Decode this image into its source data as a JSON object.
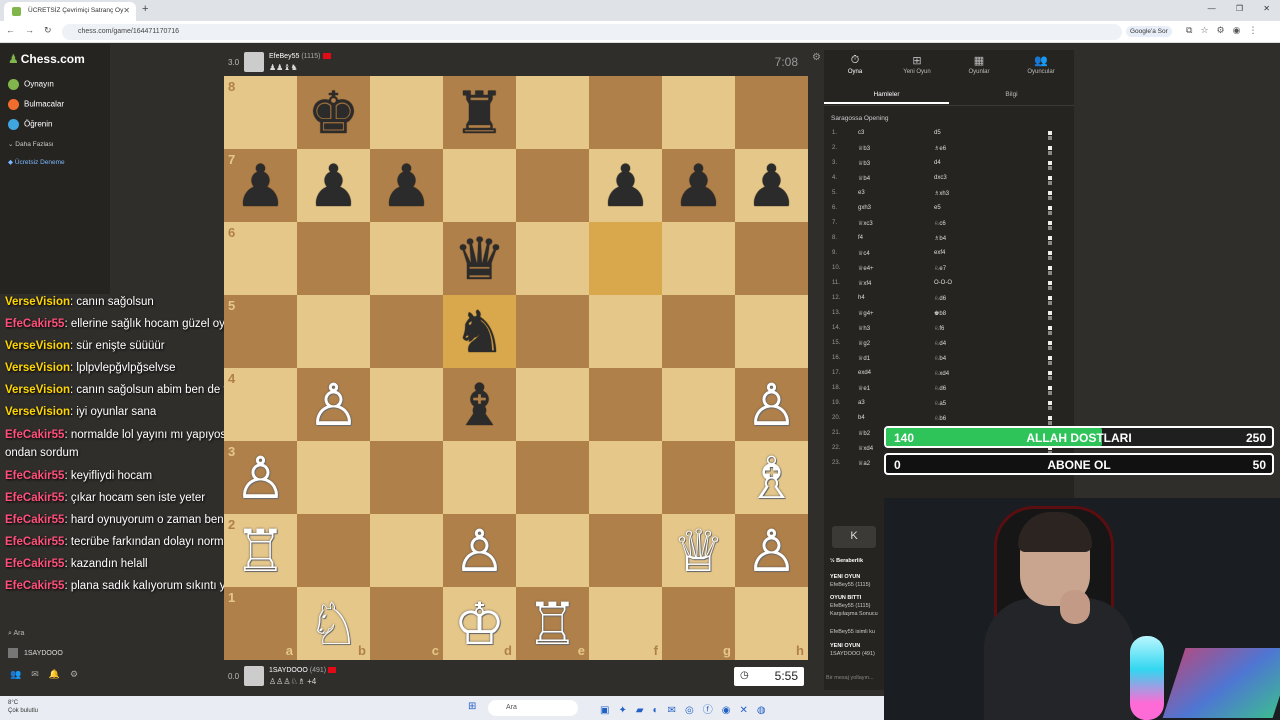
{
  "browser": {
    "tab_title": "ÜCRETSİZ Çevrimiçi Satranç Oy",
    "url": "chess.com/game/164471170716",
    "google_button": "Google'a Sor"
  },
  "leftnav": {
    "logo": "Chess.com",
    "items": [
      {
        "label": "Oynayın",
        "color": "#81b64c"
      },
      {
        "label": "Bulmacalar",
        "color": "#f16d2d"
      },
      {
        "label": "Öğrenin",
        "color": "#3fa7e0"
      },
      {
        "label": "Daha Fazlası"
      },
      {
        "label": "Ücretsiz Deneme"
      }
    ],
    "search": "Ara",
    "username": "1SAYDOOO"
  },
  "chat": [
    {
      "user": "VerseVision",
      "text": ": canın sağolsun",
      "cls": "u1"
    },
    {
      "user": "EfeCakir55",
      "text": ": ellerine sağlık hocam güzel oyundu",
      "cls": "u2"
    },
    {
      "user": "VerseVision",
      "text": ": sür enişte süüüür",
      "cls": "u1"
    },
    {
      "user": "VerseVision",
      "text": ": lplpvlepğvlpğselvse",
      "cls": "u1"
    },
    {
      "user": "VerseVision",
      "text": ": canın sağolsun abim ben de fazla duramayacam",
      "cls": "u1"
    },
    {
      "user": "VerseVision",
      "text": ": iyi oyunlar sana",
      "cls": "u1"
    },
    {
      "user": "EfeCakir55",
      "text": ": normalde lol yayını mı yapıyosun hocam arkadş demişti ya ondan sordum",
      "cls": "u2"
    },
    {
      "user": "EfeCakir55",
      "text": ": keyifliydi hocam",
      "cls": "u2"
    },
    {
      "user": "EfeCakir55",
      "text": ": çıkar hocam sen iste yeter",
      "cls": "u2"
    },
    {
      "user": "EfeCakir55",
      "text": ": hard oynuyorum o zaman bende hadi bakalımm",
      "cls": "u2"
    },
    {
      "user": "EfeCakir55",
      "text": ": tecrübe farkından dolayı normal ya ben çok oynadım",
      "cls": "u2"
    },
    {
      "user": "EfeCakir55",
      "text": ": kazandın helall",
      "cls": "u2"
    },
    {
      "user": "EfeCakir55",
      "text": ": plana sadık kalıyorum sıkıntı yokk",
      "cls": "u2"
    }
  ],
  "top_player": {
    "score": "3.0",
    "name": "EfeBey55",
    "rating": "(1115)",
    "captured": "♟♟♝♞",
    "clock": "7:08"
  },
  "bottom_player": {
    "score": "0.0",
    "name": "1SAYDOOO",
    "rating": "(491)",
    "captured": "♙♙♙♘♗ +4",
    "clock": "5:55"
  },
  "board": {
    "ranks": [
      "8",
      "7",
      "6",
      "5",
      "4",
      "3",
      "2",
      "1"
    ],
    "files": [
      "a",
      "b",
      "c",
      "d",
      "e",
      "f",
      "g",
      "h"
    ],
    "highlight": [
      "f6",
      "d5"
    ],
    "position": {
      "b8": "♚",
      "d8": "♜",
      "a7": "♟",
      "b7": "♟",
      "c7": "♟",
      "f7": "♟",
      "g7": "♟",
      "h7": "♟",
      "d6": "♛",
      "d5": "♞",
      "b4": "♙",
      "d4": "♝",
      "h4": "♙",
      "a3": "♙",
      "h3": "♗",
      "a2": "♖",
      "d2": "♙",
      "g2": "♕",
      "h2": "♙",
      "b1": "♘",
      "d1": "♔",
      "e1": "♖"
    }
  },
  "rightpanel": {
    "tabs": [
      "Oyna",
      "Yeni Oyun",
      "Oyunlar",
      "Oyuncular"
    ],
    "subtabs": [
      "Hamleler",
      "Bilgi"
    ],
    "opening": "Saragossa Opening",
    "moves": [
      {
        "n": "1.",
        "w": "c3",
        "b": "d5"
      },
      {
        "n": "2.",
        "w": "♕b3",
        "b": "♗e6"
      },
      {
        "n": "3.",
        "w": "♕b3",
        "b": "d4"
      },
      {
        "n": "4.",
        "w": "♕b4",
        "b": "dxc3"
      },
      {
        "n": "5.",
        "w": "e3",
        "b": "♗xh3"
      },
      {
        "n": "6.",
        "w": "gxh3",
        "b": "e5"
      },
      {
        "n": "7.",
        "w": "♕xc3",
        "b": "♘c6"
      },
      {
        "n": "8.",
        "w": "f4",
        "b": "♗b4"
      },
      {
        "n": "9.",
        "w": "♕c4",
        "b": "exf4"
      },
      {
        "n": "10.",
        "w": "♕e4+",
        "b": "♘e7"
      },
      {
        "n": "11.",
        "w": "♕xf4",
        "b": "O-O-O"
      },
      {
        "n": "12.",
        "w": "h4",
        "b": "♘d6"
      },
      {
        "n": "13.",
        "w": "♕g4+",
        "b": "♚b8"
      },
      {
        "n": "14.",
        "w": "♕h3",
        "b": "♘f6"
      },
      {
        "n": "15.",
        "w": "♕g2",
        "b": "♘d4"
      },
      {
        "n": "16.",
        "w": "♕d1",
        "b": "♘b4"
      },
      {
        "n": "17.",
        "w": "exd4",
        "b": "♘xd4"
      },
      {
        "n": "18.",
        "w": "♕e1",
        "b": "♘d6"
      },
      {
        "n": "19.",
        "w": "a3",
        "b": "♘a5"
      },
      {
        "n": "20.",
        "w": "b4",
        "b": "♘b6"
      },
      {
        "n": "21.",
        "w": "♕b2",
        "b": ""
      },
      {
        "n": "22.",
        "w": "♕xd4",
        "b": ""
      },
      {
        "n": "23.",
        "w": "♕a2",
        "b": "♘d5"
      }
    ],
    "nav_button": "K",
    "log": [
      {
        "t": "½ Beraberlik",
        "hdr": true
      },
      {
        "t": "YENİ OYUN",
        "hdr": true
      },
      {
        "t": "EfeBey55 (1115)",
        "hdr": false
      },
      {
        "t": "OYUN BİTTİ",
        "hdr": true
      },
      {
        "t": "EfeBey55 (1115)",
        "hdr": false
      },
      {
        "t": "Karşılaşma Sonucu",
        "hdr": false
      },
      {
        "t": "EfeBey55 isimli ku",
        "hdr": false
      },
      {
        "t": "YENİ OYUN",
        "hdr": true
      },
      {
        "t": "1SAYDOOO (491)",
        "hdr": false
      }
    ],
    "message_placeholder": "Bir mesaj yollayın..."
  },
  "goals": [
    {
      "left": "140",
      "center": "ALLAH DOSTLARI",
      "right": "250",
      "progress": 0.56
    },
    {
      "left": "0",
      "center": "ABONE OL",
      "right": "50",
      "progress": 0
    }
  ],
  "taskbar": {
    "weather_temp": "8°C",
    "weather_desc": "Çok bulutlu",
    "search": "Ara"
  }
}
